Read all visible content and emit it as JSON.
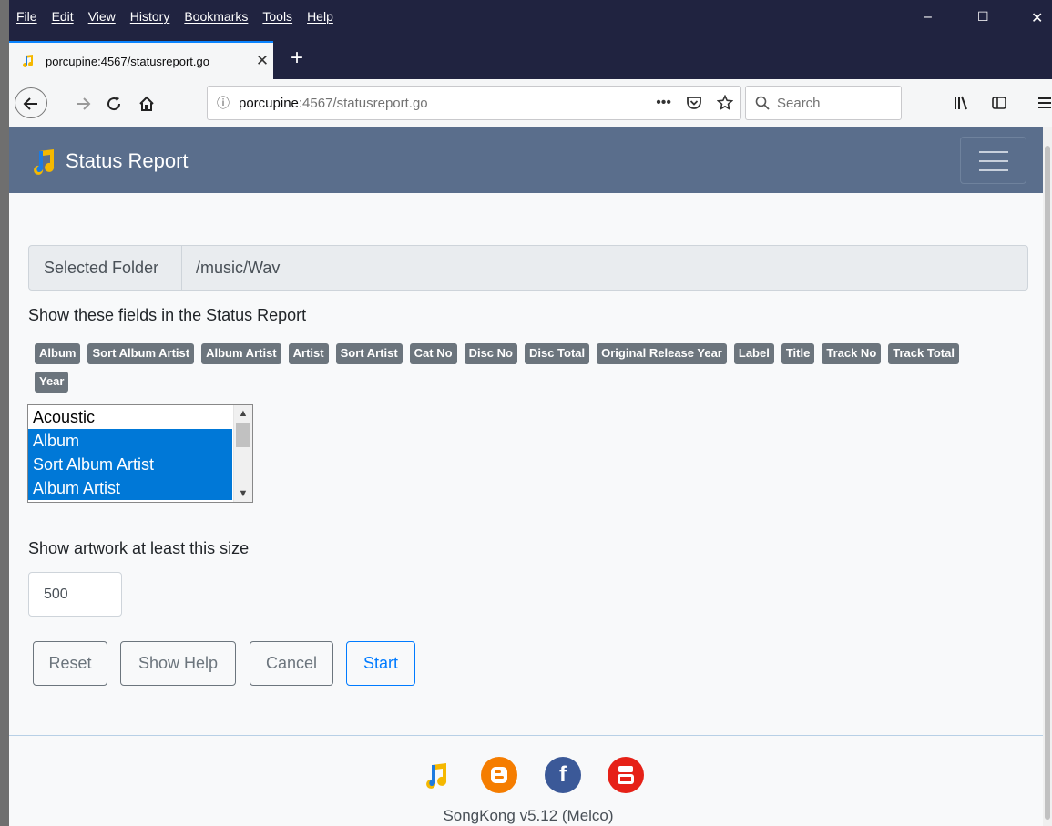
{
  "browser": {
    "menu": [
      "File",
      "Edit",
      "View",
      "History",
      "Bookmarks",
      "Tools",
      "Help"
    ],
    "window_controls": [
      "–",
      "☐",
      "✕"
    ],
    "tab": {
      "title": "porcupine:4567/statusreport.go",
      "close": "✕"
    },
    "new_tab": "+",
    "url": {
      "host": "porcupine",
      "path": ":4567/statusreport.go"
    },
    "url_actions": [
      "•••"
    ],
    "search_placeholder": "Search"
  },
  "app": {
    "brand": "Status Report"
  },
  "form": {
    "folder_label": "Selected Folder",
    "folder_value": "/music/Wav",
    "fields_label": "Show these fields in the Status Report",
    "field_badges": [
      "Album",
      "Sort Album Artist",
      "Album Artist",
      "Artist",
      "Sort Artist",
      "Cat No",
      "Disc No",
      "Disc Total",
      "Original Release Year",
      "Label",
      "Title",
      "Track No",
      "Track Total",
      "Year"
    ],
    "field_options": [
      {
        "label": "Acoustic",
        "selected": false
      },
      {
        "label": "Album",
        "selected": true
      },
      {
        "label": "Sort Album Artist",
        "selected": true
      },
      {
        "label": "Album Artist",
        "selected": true
      }
    ],
    "artwork_label": "Show artwork at least this size",
    "artwork_value": "500",
    "buttons": {
      "reset": "Reset",
      "help": "Show Help",
      "cancel": "Cancel",
      "start": "Start"
    }
  },
  "footer": {
    "icons": [
      "songkong-icon",
      "blogger-icon",
      "facebook-icon",
      "youtube-icon"
    ],
    "version": "SongKong v5.12 (Melco)"
  },
  "colors": {
    "navbar": "#5a6e8c",
    "badge": "#6c757d",
    "primary": "#007bff",
    "selection": "#0078d7",
    "browser_chrome": "#202340"
  }
}
